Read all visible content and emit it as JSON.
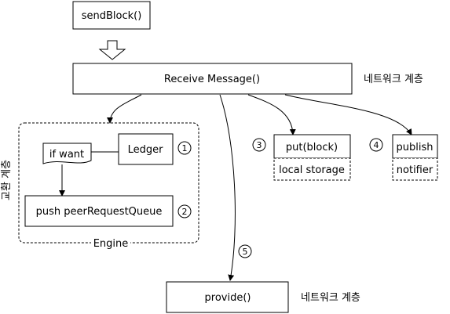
{
  "nodes": {
    "send_block": "sendBlock()",
    "receive_message": "Receive Message()",
    "network_layer_top": "네트워크 계층",
    "if_want": "if want",
    "ledger": "Ledger",
    "push_queue": "push peerRequestQueue",
    "engine": "Engine",
    "exchange_layer": "교환 계층",
    "put_block": "put(block)",
    "local_storage": "local storage",
    "publish": "publish",
    "notifier": "notifier",
    "provide": "provide()",
    "network_layer_bottom": "네트워크 계층"
  },
  "markers": {
    "m1": "1",
    "m2": "2",
    "m3": "3",
    "m4": "4",
    "m5": "5"
  },
  "colors": {
    "stroke": "#000000",
    "background": "#ffffff"
  }
}
